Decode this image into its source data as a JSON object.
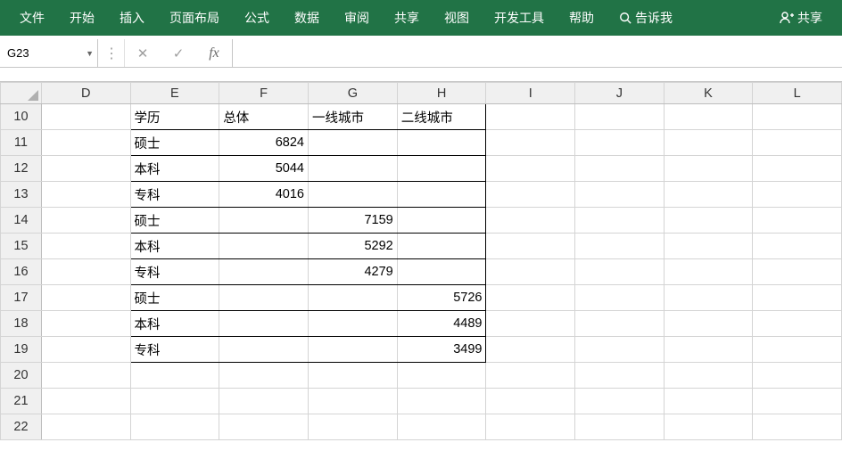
{
  "ribbon": {
    "tabs": [
      "文件",
      "开始",
      "插入",
      "页面布局",
      "公式",
      "数据",
      "审阅",
      "共享",
      "视图",
      "开发工具",
      "帮助"
    ],
    "tell_me": "告诉我",
    "share": "共享"
  },
  "formula_bar": {
    "name_box": "G23",
    "cancel": "✕",
    "enter": "✓",
    "fx": "fx",
    "input": ""
  },
  "columns": [
    "D",
    "E",
    "F",
    "G",
    "H",
    "I",
    "J",
    "K",
    "L"
  ],
  "rows": [
    "10",
    "11",
    "12",
    "13",
    "14",
    "15",
    "16",
    "17",
    "18",
    "19",
    "20",
    "21",
    "22"
  ],
  "cells": {
    "r10": {
      "E": "学历",
      "F": "总体",
      "G": "一线城市",
      "H": "二线城市"
    },
    "r11": {
      "E": "硕士",
      "F": "6824"
    },
    "r12": {
      "E": "本科",
      "F": "5044"
    },
    "r13": {
      "E": "专科",
      "F": "4016"
    },
    "r14": {
      "E": "硕士",
      "G": "7159"
    },
    "r15": {
      "E": "本科",
      "G": "5292"
    },
    "r16": {
      "E": "专科",
      "G": "4279"
    },
    "r17": {
      "E": "硕士",
      "H": "5726"
    },
    "r18": {
      "E": "本科",
      "H": "4489"
    },
    "r19": {
      "E": "专科",
      "H": "3499"
    }
  },
  "chart_data": {
    "type": "table",
    "title": "",
    "headers": [
      "学历",
      "总体",
      "一线城市",
      "二线城市"
    ],
    "rows": [
      {
        "学历": "硕士",
        "总体": 6824,
        "一线城市": null,
        "二线城市": null
      },
      {
        "学历": "本科",
        "总体": 5044,
        "一线城市": null,
        "二线城市": null
      },
      {
        "学历": "专科",
        "总体": 4016,
        "一线城市": null,
        "二线城市": null
      },
      {
        "学历": "硕士",
        "总体": null,
        "一线城市": 7159,
        "二线城市": null
      },
      {
        "学历": "本科",
        "总体": null,
        "一线城市": 5292,
        "二线城市": null
      },
      {
        "学历": "专科",
        "总体": null,
        "一线城市": 4279,
        "二线城市": null
      },
      {
        "学历": "硕士",
        "总体": null,
        "一线城市": null,
        "二线城市": 5726
      },
      {
        "学历": "本科",
        "总体": null,
        "一线城市": null,
        "二线城市": 4489
      },
      {
        "学历": "专科",
        "总体": null,
        "一线城市": null,
        "二线城市": 3499
      }
    ]
  }
}
